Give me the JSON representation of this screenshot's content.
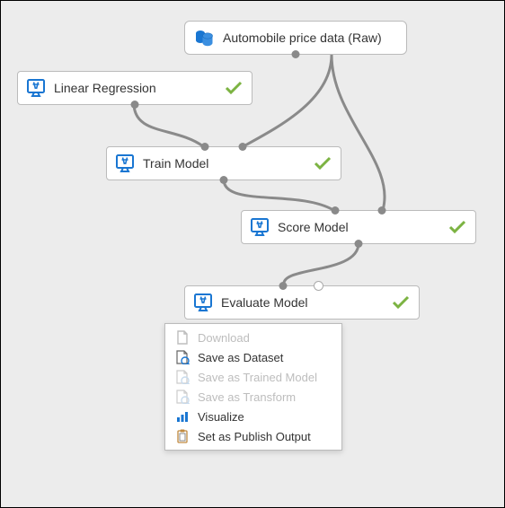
{
  "nodes": {
    "data": {
      "label": "Automobile price data (Raw)"
    },
    "linreg": {
      "label": "Linear Regression"
    },
    "train": {
      "label": "Train Model"
    },
    "score": {
      "label": "Score Model"
    },
    "evaluate": {
      "label": "Evaluate Model"
    }
  },
  "menu": {
    "items": [
      {
        "label": "Download",
        "enabled": false
      },
      {
        "label": "Save as Dataset",
        "enabled": true
      },
      {
        "label": "Save as Trained Model",
        "enabled": false
      },
      {
        "label": "Save as Transform",
        "enabled": false
      },
      {
        "label": "Visualize",
        "enabled": true
      },
      {
        "label": "Set as Publish Output",
        "enabled": true
      }
    ]
  }
}
